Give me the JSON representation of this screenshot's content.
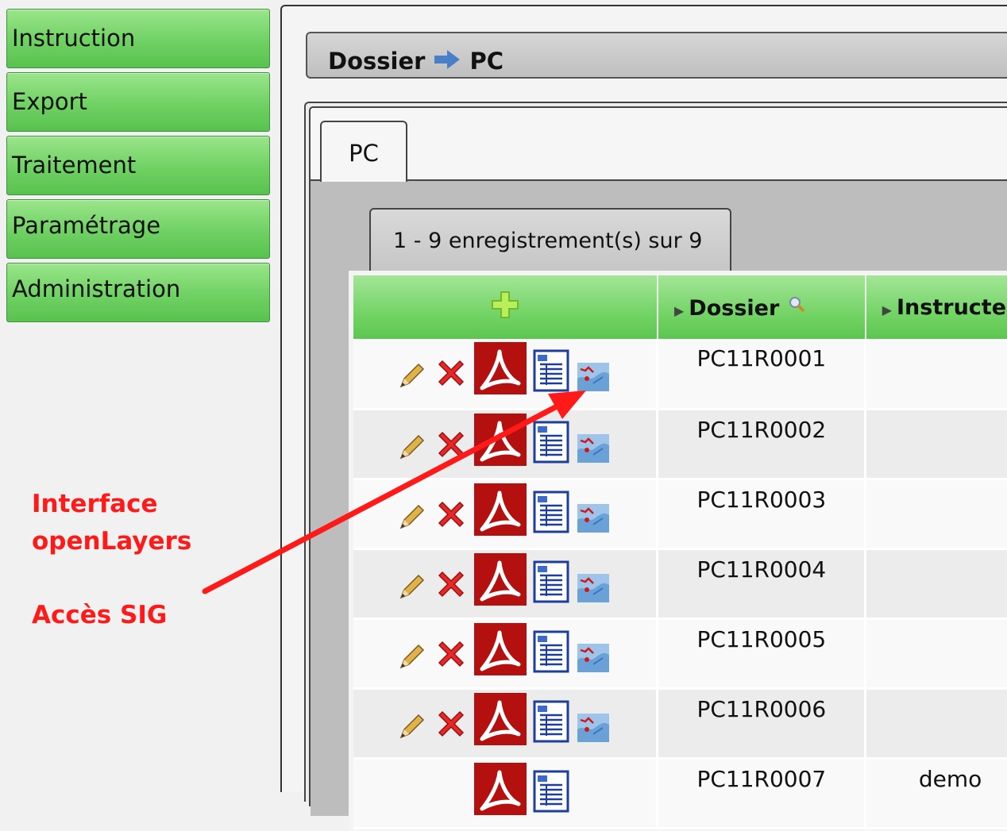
{
  "menu": {
    "items": [
      {
        "label": "Instruction"
      },
      {
        "label": "Export"
      },
      {
        "label": "Traitement"
      },
      {
        "label": "Paramétrage"
      },
      {
        "label": "Administration"
      }
    ]
  },
  "annotation": {
    "line1": "Interface",
    "line2": "openLayers",
    "line3": "Accès SIG",
    "color": "#ff1a1a"
  },
  "breadcrumb": {
    "root": "Dossier",
    "current": "PC"
  },
  "tab": {
    "label": "PC"
  },
  "pager": {
    "text": "1 - 9 enregistrement(s) sur 9"
  },
  "table": {
    "headers": {
      "dossier": "Dossier",
      "instructeur": "Instructe"
    },
    "rows": [
      {
        "dossier": "PC11R0001",
        "instructeur": ""
      },
      {
        "dossier": "PC11R0002",
        "instructeur": ""
      },
      {
        "dossier": "PC11R0003",
        "instructeur": ""
      },
      {
        "dossier": "PC11R0004",
        "instructeur": ""
      },
      {
        "dossier": "PC11R0005",
        "instructeur": ""
      },
      {
        "dossier": "PC11R0006",
        "instructeur": ""
      },
      {
        "dossier": "PC11R0007",
        "instructeur": "demo"
      }
    ]
  },
  "colors": {
    "menu_green": "#6fd163",
    "header_green": "#74d466",
    "pdf_red": "#b3100f",
    "arrow_red": "#ff1a1a"
  }
}
